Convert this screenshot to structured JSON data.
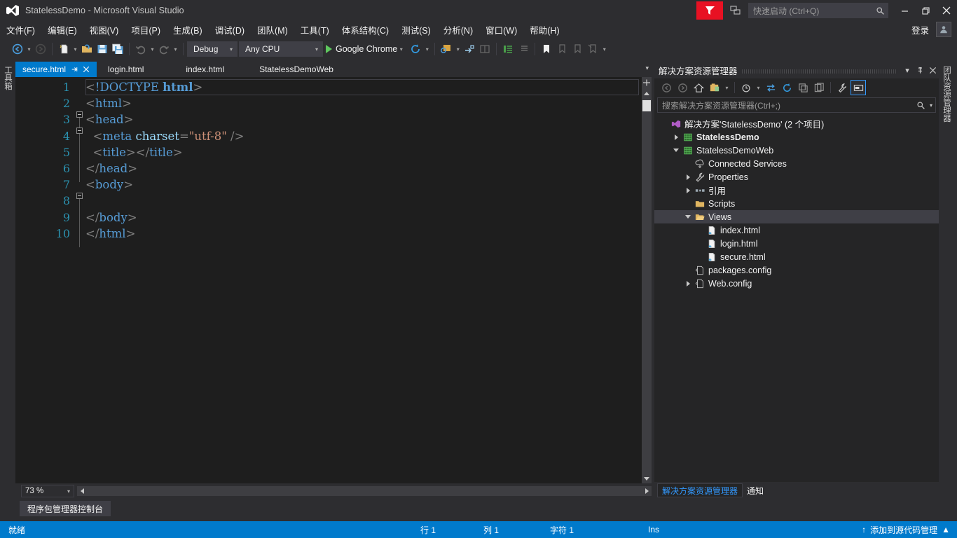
{
  "window": {
    "title": "StatelessDemo - Microsoft Visual Studio",
    "logo_icon": "visual-studio-logo",
    "minimize_label": "–",
    "maximize_label": "❐",
    "close_label": "✕"
  },
  "titlebar": {
    "flag_icon": "feedback-flag-icon",
    "feedback_icon": "send-feedback-icon",
    "quick_launch_placeholder": "快速启动 (Ctrl+Q)",
    "search_icon": "search-icon"
  },
  "menu": {
    "items": [
      {
        "label": "文件(F)"
      },
      {
        "label": "编辑(E)"
      },
      {
        "label": "视图(V)"
      },
      {
        "label": "项目(P)"
      },
      {
        "label": "生成(B)"
      },
      {
        "label": "调试(D)"
      },
      {
        "label": "团队(M)"
      },
      {
        "label": "工具(T)"
      },
      {
        "label": "体系结构(C)"
      },
      {
        "label": "测试(S)"
      },
      {
        "label": "分析(N)"
      },
      {
        "label": "窗口(W)"
      },
      {
        "label": "帮助(H)"
      }
    ],
    "signin_label": "登录",
    "avatar_icon": "user-avatar-icon"
  },
  "toolbar": {
    "nav_back_icon": "navigate-back-icon",
    "nav_forward_icon": "navigate-forward-icon",
    "new_project_icon": "new-project-icon",
    "open_file_icon": "open-file-icon",
    "save_icon": "save-icon",
    "save_all_icon": "save-all-icon",
    "undo_icon": "undo-icon",
    "redo_icon": "redo-icon",
    "configuration": "Debug",
    "platform": "Any CPU",
    "start_label": "Google Chrome",
    "start_icon": "play-icon",
    "refresh_icon": "refresh-browser-icon",
    "attach_icon": "attach-to-process-icon",
    "step_icon": "step-icon",
    "comment_icon": "comment-icon",
    "uncomment_icon": "uncomment-icon",
    "indent_icon": "indent-icon",
    "outdent_icon": "outdent-icon",
    "bookmark_icon": "bookmark-icon",
    "bookmark_prev_icon": "previous-bookmark-icon",
    "bookmark_next_icon": "next-bookmark-icon",
    "bookmark_clear_icon": "clear-bookmarks-icon",
    "overflow_icon": "toolbar-overflow-icon"
  },
  "left_dock": {
    "toolbox_label": "工具箱"
  },
  "right_dock": {
    "team_explorer_label": "团队资源管理器"
  },
  "editor": {
    "tabs": [
      {
        "label": "secure.html",
        "active": true,
        "pin_icon": "pin-icon",
        "close_icon": "close-icon"
      },
      {
        "label": "login.html",
        "active": false
      },
      {
        "label": "index.html",
        "active": false
      },
      {
        "label": "StatelessDemoWeb",
        "active": false
      }
    ],
    "tabstrip_caret_icon": "chevron-down-icon",
    "split_icon": "split-view-icon",
    "zoom_level": "73 %",
    "lines": [
      {
        "n": "1",
        "fold": "none",
        "guide": "none",
        "tokens": [
          {
            "t": "br",
            "v": "<"
          },
          {
            "t": "doc",
            "v": "!DOCTYPE "
          },
          {
            "t": "tag-bold",
            "v": "html"
          },
          {
            "t": "br",
            "v": ">"
          }
        ]
      },
      {
        "n": "2",
        "fold": "box",
        "guide": "half-top",
        "tokens": [
          {
            "t": "br",
            "v": "<"
          },
          {
            "t": "tag",
            "v": "html"
          },
          {
            "t": "br",
            "v": ">"
          }
        ]
      },
      {
        "n": "3",
        "fold": "box",
        "guide": "full",
        "tokens": [
          {
            "t": "br",
            "v": "<"
          },
          {
            "t": "tag",
            "v": "head"
          },
          {
            "t": "br",
            "v": ">"
          }
        ]
      },
      {
        "n": "4",
        "fold": "none",
        "guide": "full",
        "tokens": [
          {
            "t": "plain",
            "v": "  "
          },
          {
            "t": "br",
            "v": "<"
          },
          {
            "t": "tag",
            "v": "meta"
          },
          {
            "t": "plain",
            "v": " "
          },
          {
            "t": "attr",
            "v": "charset"
          },
          {
            "t": "br",
            "v": "="
          },
          {
            "t": "val",
            "v": "\"utf-8\""
          },
          {
            "t": "plain",
            "v": " "
          },
          {
            "t": "br",
            "v": "/>"
          }
        ]
      },
      {
        "n": "5",
        "fold": "none",
        "guide": "full",
        "tokens": [
          {
            "t": "plain",
            "v": "  "
          },
          {
            "t": "br",
            "v": "<"
          },
          {
            "t": "tag",
            "v": "title"
          },
          {
            "t": "br",
            "v": "></"
          },
          {
            "t": "tag",
            "v": "title"
          },
          {
            "t": "br",
            "v": ">"
          }
        ]
      },
      {
        "n": "6",
        "fold": "none",
        "guide": "half-bot",
        "tokens": [
          {
            "t": "br",
            "v": "</"
          },
          {
            "t": "tag",
            "v": "head"
          },
          {
            "t": "br",
            "v": ">"
          }
        ]
      },
      {
        "n": "7",
        "fold": "box",
        "guide": "half-top",
        "tokens": [
          {
            "t": "br",
            "v": "<"
          },
          {
            "t": "tag",
            "v": "body"
          },
          {
            "t": "br",
            "v": ">"
          }
        ]
      },
      {
        "n": "8",
        "fold": "none",
        "guide": "full",
        "tokens": []
      },
      {
        "n": "9",
        "fold": "none",
        "guide": "full",
        "tokens": [
          {
            "t": "br",
            "v": "</"
          },
          {
            "t": "tag",
            "v": "body"
          },
          {
            "t": "br",
            "v": ">"
          }
        ]
      },
      {
        "n": "10",
        "fold": "none",
        "guide": "half-bot",
        "tokens": [
          {
            "t": "br",
            "v": "</"
          },
          {
            "t": "tag",
            "v": "html"
          },
          {
            "t": "br",
            "v": ">"
          }
        ]
      }
    ]
  },
  "bottom_panel": {
    "tab_label": "程序包管理器控制台"
  },
  "solution_explorer": {
    "title": "解决方案资源管理器",
    "dropdown_icon": "chevron-down-icon",
    "pin_icon": "pin-icon",
    "close_icon": "close-icon",
    "toolbar_icons": [
      "back-icon",
      "forward-icon",
      "home-icon",
      "show-all-files-icon",
      "dropdown-icon",
      "pending-changes-icon",
      "sync-icon",
      "refresh-icon",
      "collapse-all-icon",
      "properties-icon",
      "show-properties-window-icon",
      "preview-selected-items-icon"
    ],
    "search_placeholder": "搜索解决方案资源管理器(Ctrl+;)",
    "search_icon": "search-icon",
    "tree": [
      {
        "label": "解决方案'StatelessDemo' (2 个项目)",
        "indent": 0,
        "expander": "none",
        "icon": "solution-icon",
        "bold": false,
        "selected": false
      },
      {
        "label": "StatelessDemo",
        "indent": 1,
        "expander": "collapsed",
        "icon": "project-icon",
        "bold": true,
        "selected": false
      },
      {
        "label": "StatelessDemoWeb",
        "indent": 1,
        "expander": "expanded",
        "icon": "project-icon",
        "bold": false,
        "selected": false
      },
      {
        "label": "Connected Services",
        "indent": 2,
        "expander": "none",
        "icon": "connected-services-icon",
        "bold": false,
        "selected": false
      },
      {
        "label": "Properties",
        "indent": 2,
        "expander": "collapsed",
        "icon": "properties-wrench-icon",
        "bold": false,
        "selected": false
      },
      {
        "label": "引用",
        "indent": 2,
        "expander": "collapsed",
        "icon": "references-icon",
        "bold": false,
        "selected": false
      },
      {
        "label": "Scripts",
        "indent": 2,
        "expander": "none",
        "icon": "folder-icon",
        "bold": false,
        "selected": false
      },
      {
        "label": "Views",
        "indent": 2,
        "expander": "expanded",
        "icon": "folder-open-icon",
        "bold": false,
        "selected": true
      },
      {
        "label": "index.html",
        "indent": 3,
        "expander": "none",
        "icon": "html-file-icon",
        "bold": false,
        "selected": false
      },
      {
        "label": "login.html",
        "indent": 3,
        "expander": "none",
        "icon": "html-file-icon",
        "bold": false,
        "selected": false
      },
      {
        "label": "secure.html",
        "indent": 3,
        "expander": "none",
        "icon": "html-file-icon",
        "bold": false,
        "selected": false
      },
      {
        "label": "packages.config",
        "indent": 2,
        "expander": "none",
        "icon": "config-file-icon",
        "bold": false,
        "selected": false
      },
      {
        "label": "Web.config",
        "indent": 2,
        "expander": "collapsed",
        "icon": "config-file-icon",
        "bold": false,
        "selected": false
      }
    ],
    "bottom_tabs": [
      {
        "label": "解决方案资源管理器",
        "active": true
      },
      {
        "label": "通知",
        "active": false
      }
    ]
  },
  "status_bar": {
    "ready": "就绪",
    "line": "行 1",
    "column": "列 1",
    "character": "字符 1",
    "insert_mode": "Ins",
    "source_control": "添加到源代码管理",
    "source_control_icon": "arrow-up-icon",
    "source_control_caret": "▲"
  },
  "colors": {
    "accent": "#007acc",
    "chrome": "#2d2d30",
    "editor_bg": "#1e1e1e",
    "panel_bg": "#252526",
    "flag_red": "#e81123",
    "line_number": "#2b91af"
  }
}
